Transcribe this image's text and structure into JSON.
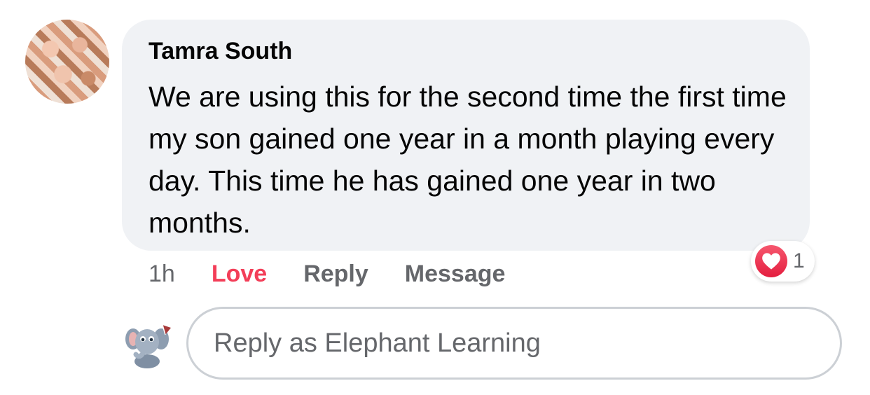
{
  "comment": {
    "author": "Tamra South",
    "text": "We are using this for the second time the first time my son gained one year in a month playing every day. This time he has gained one year in two months.",
    "time": "1h",
    "actions": {
      "love": "Love",
      "reply": "Reply",
      "message": "Message"
    },
    "reaction": {
      "icon": "heart-icon",
      "count": "1",
      "color": "#f33e58"
    }
  },
  "reply_box": {
    "placeholder": "Reply as Elephant Learning",
    "avatar_icon": "elephant-icon"
  }
}
